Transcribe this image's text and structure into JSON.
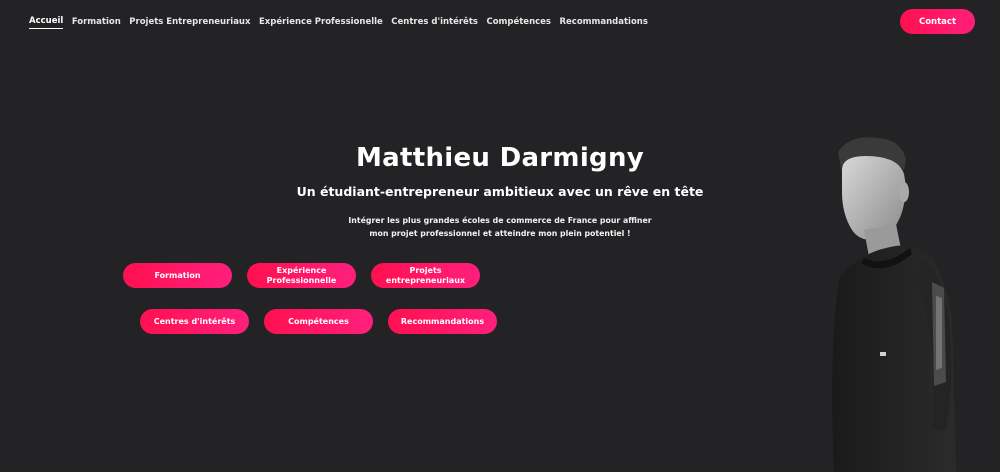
{
  "nav": {
    "links": [
      "Accueil",
      "Formation",
      "Projets Entrepreneuriaux",
      "Expérience Professionelle",
      "Centres d'intérêts",
      "Compétences",
      "Recommandations"
    ],
    "active": "Accueil",
    "contact_label": "Contact"
  },
  "hero": {
    "name": "Matthieu Darmigny",
    "tagline": "Un étudiant-entrepreneur ambitieux avec un rêve en tête",
    "desc_line1": "Intégrer les plus grandes écoles de commerce de France pour affiner",
    "desc_line2": "mon projet professionnel et atteindre mon plein potentiel !"
  },
  "buttons": {
    "formation": "Formation",
    "experience_line1": "Expérience",
    "experience_line2": "Professionnelle",
    "projets_line1": "Projets",
    "projets_line2": "entrepreneuriaux",
    "centres": "Centres d'intérêts",
    "competences": "Compétences",
    "recommandations": "Recommandations"
  },
  "colors": {
    "background": "#232326",
    "accent": "#ff1050",
    "accent_end": "#ff1f7a"
  },
  "icons": {
    "portrait": "person-photo"
  }
}
